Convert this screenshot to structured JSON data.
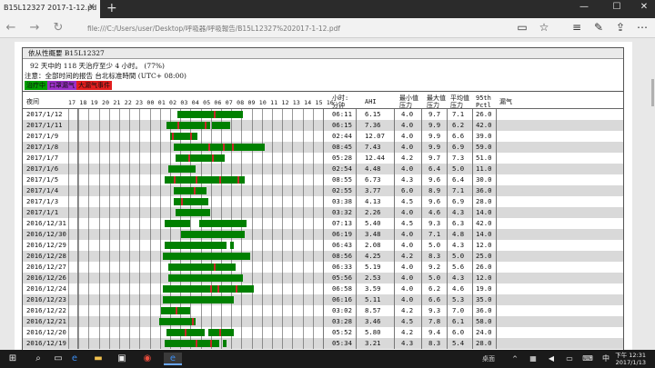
{
  "browser": {
    "tab_title": "B15L12327 2017-1-12.pd",
    "url": "file:///C:/Users/user/Desktop/呼吸器/呼吸報告/B15L12327%202017-1-12.pdf"
  },
  "summary": {
    "title": "依从性概要 B15L12327",
    "line2": "92 天中的 118 天治疗至少 4 小时。 (77%)",
    "line3": "注意：全部时间的报告 台北标准時間 (UTC+ 08:00)",
    "legend": [
      {
        "label": "治疗中",
        "color": "#00a000"
      },
      {
        "label": "口罩漏气",
        "color": "#9b30c8"
      },
      {
        "label": "大漏气事件",
        "color": "#e21e1e"
      }
    ]
  },
  "table": {
    "headers": {
      "night": "夜间",
      "hours": "17 18 19 20 21 22 23 00 01 02 03 04 05 06 07 08 09 10 11 12 13 14 15 16",
      "usage": "小时:分钟",
      "ahi": "AHI",
      "min_pressure": "最小值压力",
      "max_pressure": "最大值压力",
      "avg_pressure": "平均值压力",
      "p95": "95th Pctl",
      "leak": "漏气"
    },
    "rows": [
      {
        "date": "2017/1/12",
        "usage": "06:11",
        "ahi": "6.15",
        "min": "4.0",
        "max": "9.7",
        "avg": "7.1",
        "p95": "26.0"
      },
      {
        "date": "2017/1/11",
        "usage": "06:15",
        "ahi": "7.36",
        "min": "4.0",
        "max": "9.9",
        "avg": "6.2",
        "p95": "42.0"
      },
      {
        "date": "2017/1/9",
        "usage": "02:44",
        "ahi": "12.07",
        "min": "4.0",
        "max": "9.9",
        "avg": "6.6",
        "p95": "39.0"
      },
      {
        "date": "2017/1/8",
        "usage": "08:45",
        "ahi": "7.43",
        "min": "4.0",
        "max": "9.9",
        "avg": "6.9",
        "p95": "59.0"
      },
      {
        "date": "2017/1/7",
        "usage": "05:28",
        "ahi": "12.44",
        "min": "4.2",
        "max": "9.7",
        "avg": "7.3",
        "p95": "51.0"
      },
      {
        "date": "2017/1/6",
        "usage": "02:54",
        "ahi": "4.48",
        "min": "4.0",
        "max": "6.4",
        "avg": "5.0",
        "p95": "11.0"
      },
      {
        "date": "2017/1/5",
        "usage": "08:55",
        "ahi": "6.73",
        "min": "4.3",
        "max": "9.6",
        "avg": "6.4",
        "p95": "30.0"
      },
      {
        "date": "2017/1/4",
        "usage": "02:55",
        "ahi": "3.77",
        "min": "6.0",
        "max": "8.9",
        "avg": "7.1",
        "p95": "36.0"
      },
      {
        "date": "2017/1/3",
        "usage": "03:38",
        "ahi": "4.13",
        "min": "4.5",
        "max": "9.6",
        "avg": "6.9",
        "p95": "28.0"
      },
      {
        "date": "2017/1/1",
        "usage": "03:32",
        "ahi": "2.26",
        "min": "4.0",
        "max": "4.6",
        "avg": "4.3",
        "p95": "14.0"
      },
      {
        "date": "2016/12/31",
        "usage": "07:13",
        "ahi": "5.40",
        "min": "4.5",
        "max": "9.3",
        "avg": "6.3",
        "p95": "42.0"
      },
      {
        "date": "2016/12/30",
        "usage": "06:19",
        "ahi": "3.48",
        "min": "4.0",
        "max": "7.1",
        "avg": "4.8",
        "p95": "14.0"
      },
      {
        "date": "2016/12/29",
        "usage": "06:43",
        "ahi": "2.08",
        "min": "4.0",
        "max": "5.0",
        "avg": "4.3",
        "p95": "12.0"
      },
      {
        "date": "2016/12/28",
        "usage": "08:56",
        "ahi": "4.25",
        "min": "4.2",
        "max": "8.3",
        "avg": "5.0",
        "p95": "25.0"
      },
      {
        "date": "2016/12/27",
        "usage": "06:33",
        "ahi": "5.19",
        "min": "4.0",
        "max": "9.2",
        "avg": "5.6",
        "p95": "26.0"
      },
      {
        "date": "2016/12/26",
        "usage": "05:56",
        "ahi": "2.53",
        "min": "4.0",
        "max": "5.0",
        "avg": "4.3",
        "p95": "12.0"
      },
      {
        "date": "2016/12/24",
        "usage": "06:58",
        "ahi": "3.59",
        "min": "4.0",
        "max": "6.2",
        "avg": "4.6",
        "p95": "19.0"
      },
      {
        "date": "2016/12/23",
        "usage": "06:16",
        "ahi": "5.11",
        "min": "4.0",
        "max": "6.6",
        "avg": "5.3",
        "p95": "35.0"
      },
      {
        "date": "2016/12/22",
        "usage": "03:02",
        "ahi": "8.57",
        "min": "4.2",
        "max": "9.3",
        "avg": "7.0",
        "p95": "36.0"
      },
      {
        "date": "2016/12/21",
        "usage": "03:28",
        "ahi": "3.46",
        "min": "4.5",
        "max": "7.8",
        "avg": "6.1",
        "p95": "58.0"
      },
      {
        "date": "2016/12/20",
        "usage": "05:52",
        "ahi": "5.80",
        "min": "4.2",
        "max": "9.4",
        "avg": "6.0",
        "p95": "24.0"
      },
      {
        "date": "2016/12/19",
        "usage": "05:34",
        "ahi": "3.21",
        "min": "4.3",
        "max": "8.3",
        "avg": "5.4",
        "p95": "28.0"
      }
    ]
  },
  "taskbar": {
    "desktop_label": "桌面",
    "time": "下午 12:31",
    "date": "2017/1/13"
  }
}
